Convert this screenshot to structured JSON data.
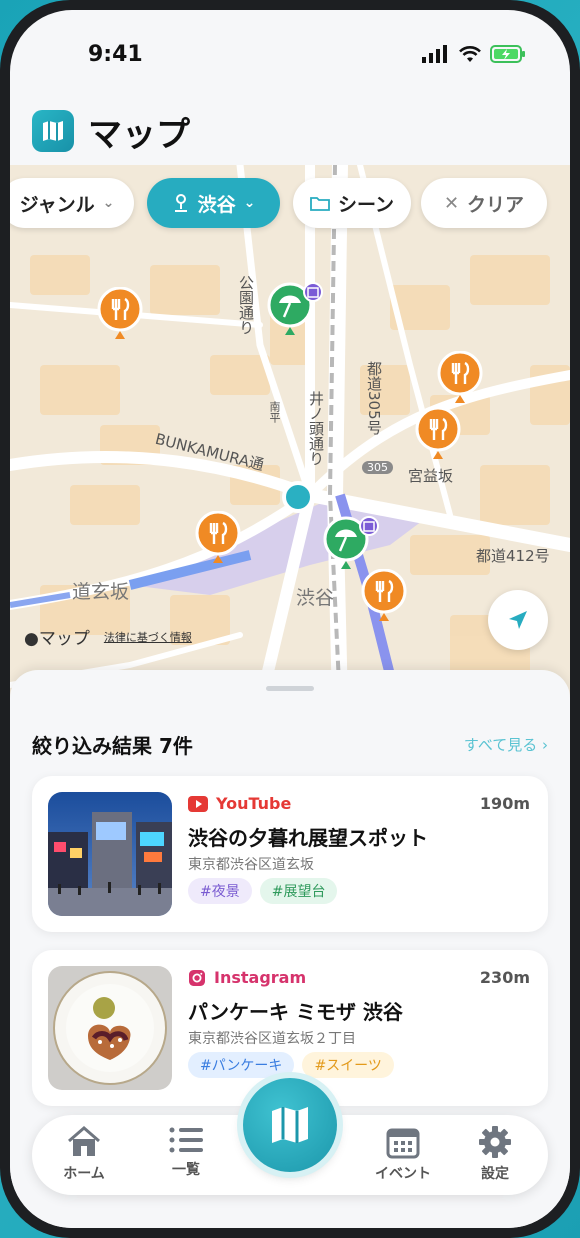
{
  "status": {
    "time": "9:41"
  },
  "header": {
    "title": "マップ",
    "app_icon": "map-icon"
  },
  "filters": {
    "genre": "ジャンル",
    "area": "渋谷",
    "scene": "シーン",
    "clear": "クリア"
  },
  "map": {
    "labels": {
      "park": "公園通り",
      "inokashira": "井ノ頭通り",
      "route305": "都道305号",
      "bunkamura": "BUNKAMURA通",
      "miyamasuzaka": "宮益坂",
      "route412": "都道412号",
      "dogenzaka": "道玄坂",
      "shibuya": "渋谷",
      "shield": "305",
      "small": "南平"
    },
    "credit": "マップ",
    "legal": "法律に基づく情報"
  },
  "results": {
    "title": "絞り込み結果 7件",
    "see_all": "すべて見る ›",
    "items": [
      {
        "source": "YouTube",
        "source_color": "#e53935",
        "distance": "190m",
        "title": "渋谷の夕暮れ展望スポット",
        "address": "東京都渋谷区道玄坂",
        "tags": [
          "#夜景",
          "#展望台"
        ]
      },
      {
        "source": "Instagram",
        "source_color": "#d6336c",
        "distance": "230m",
        "title": "パンケーキ ミモザ 渋谷",
        "address": "東京都渋谷区道玄坂２丁目",
        "tags": [
          "#パンケーキ",
          "#スイーツ"
        ]
      }
    ]
  },
  "tabbar": {
    "home": "ホーム",
    "list": "一覧",
    "event": "イベント",
    "settings": "設定"
  },
  "colors": {
    "accent": "#27acc0",
    "restaurant_pin": "#f08a24",
    "scenic_pin": "#2eaa62"
  }
}
